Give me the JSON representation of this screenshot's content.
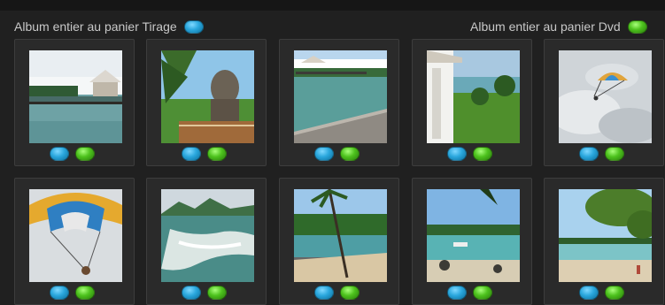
{
  "header": {
    "left_label": "Album entier au panier Tirage",
    "right_label": "Album entier au panier Dvd",
    "left_button_icon": "blue-pill-icon",
    "right_button_icon": "green-pill-icon"
  },
  "colors": {
    "blue_button": "#2aa7dd",
    "green_button": "#4dc21d",
    "background": "#202020",
    "tile_background": "#2a2a2a"
  },
  "photos": [
    {
      "id": "pier-pavilion",
      "tirage_icon": "blue-pill-icon",
      "dvd_icon": "green-pill-icon"
    },
    {
      "id": "stone-statue",
      "tirage_icon": "blue-pill-icon",
      "dvd_icon": "green-pill-icon"
    },
    {
      "id": "jetty-lagoon",
      "tirage_icon": "blue-pill-icon",
      "dvd_icon": "green-pill-icon"
    },
    {
      "id": "garden-house",
      "tirage_icon": "blue-pill-icon",
      "dvd_icon": "green-pill-icon"
    },
    {
      "id": "parasail-sky",
      "tirage_icon": "blue-pill-icon",
      "dvd_icon": "green-pill-icon"
    },
    {
      "id": "parasail-close",
      "tirage_icon": "blue-pill-icon",
      "dvd_icon": "green-pill-icon"
    },
    {
      "id": "boat-wake",
      "tirage_icon": "blue-pill-icon",
      "dvd_icon": "green-pill-icon"
    },
    {
      "id": "palm-beach",
      "tirage_icon": "blue-pill-icon",
      "dvd_icon": "green-pill-icon"
    },
    {
      "id": "lagoon-boat",
      "tirage_icon": "blue-pill-icon",
      "dvd_icon": "green-pill-icon"
    },
    {
      "id": "tree-shore",
      "tirage_icon": "blue-pill-icon",
      "dvd_icon": "green-pill-icon"
    }
  ]
}
